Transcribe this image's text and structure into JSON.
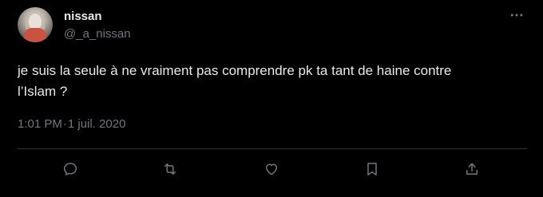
{
  "tweet": {
    "author": {
      "display_name": "nissan",
      "handle": "@_a_nissan"
    },
    "text": "je suis la seule à ne vraiment pas comprendre pk ta tant de haine contre\nl’Islam ?",
    "time": "1:01 PM",
    "separator": "·",
    "date": "1 juil. 2020"
  },
  "icons": {
    "more": "more-icon",
    "reply": "reply-icon",
    "retweet": "retweet-icon",
    "like": "heart-icon",
    "bookmark": "bookmark-icon",
    "share": "share-icon"
  },
  "colors": {
    "background": "#000000",
    "text_primary": "#e7e9ea",
    "text_secondary": "#71767b",
    "divider": "#2f3336"
  }
}
